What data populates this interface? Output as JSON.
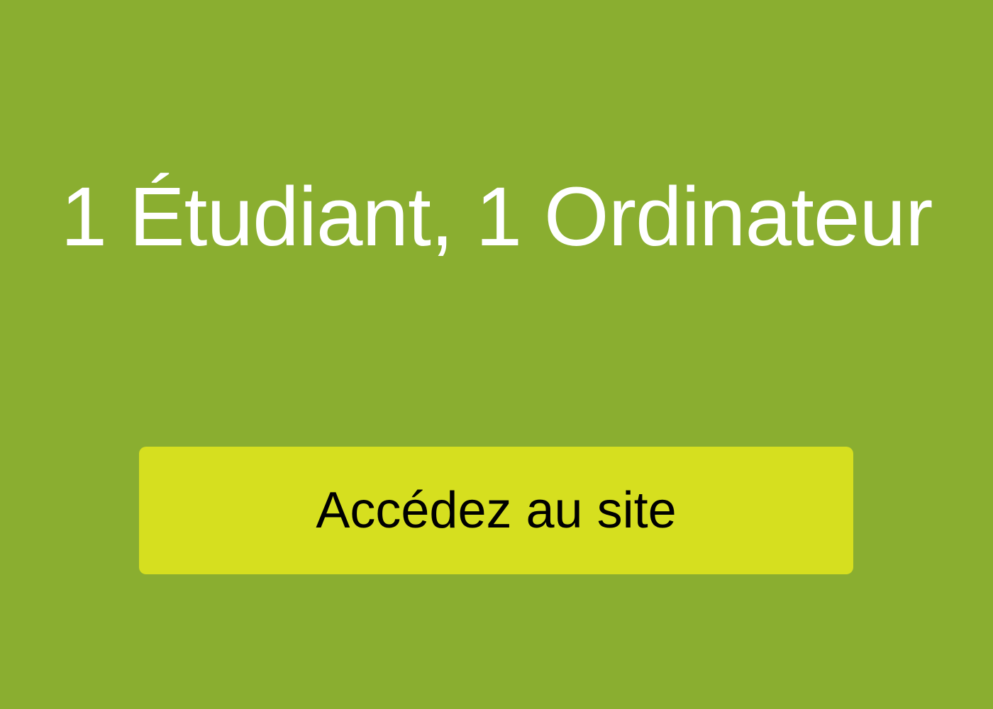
{
  "banner": {
    "headline": "1 Étudiant, 1 Ordinateur",
    "cta_label": "Accédez au site"
  },
  "colors": {
    "background": "#8aae30",
    "headline_text": "#ffffff",
    "button_background": "#d6df1f",
    "button_text": "#000000"
  }
}
